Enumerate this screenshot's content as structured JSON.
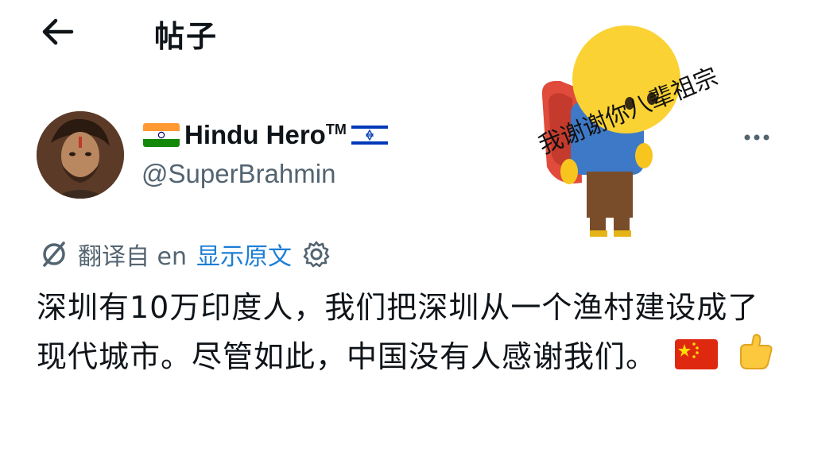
{
  "header": {
    "back_icon": "back-arrow-icon",
    "title": "帖子"
  },
  "post": {
    "author": {
      "flag_left": "india-flag-icon",
      "display_name": "Hindu Hero",
      "trademark": "TM",
      "flag_right": "israel-flag-icon",
      "handle": "@SuperBrahmin"
    },
    "translation": {
      "icon": "translate-icon",
      "translated_from": "翻译自 en",
      "show_original": "显示原文",
      "settings_icon": "gear-icon"
    },
    "body_text": "深圳有10万印度人，我们把深圳从一个渔村建设成了现代城市。尽管如此，中国没有人感谢我们。",
    "emojis": [
      "china-flag-icon",
      "thumbs-up-icon"
    ]
  },
  "sticker": {
    "caption": "我谢谢你八辈祖宗"
  },
  "colors": {
    "link": "#1d7ed6",
    "secondary_text": "#536471",
    "primary_text": "#0f1419"
  }
}
